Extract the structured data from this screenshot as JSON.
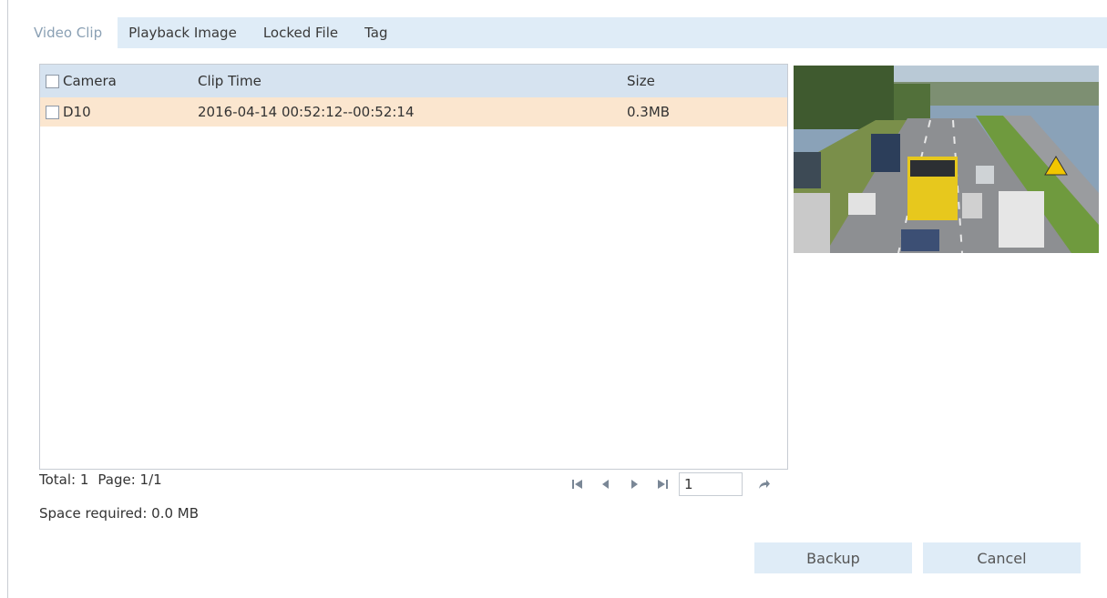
{
  "tabs": [
    {
      "label": "Video Clip",
      "active": true
    },
    {
      "label": "Playback Image",
      "active": false
    },
    {
      "label": "Locked File",
      "active": false
    },
    {
      "label": "Tag",
      "active": false
    }
  ],
  "table": {
    "headers": {
      "camera": "Camera",
      "clip_time": "Clip Time",
      "size": "Size"
    },
    "rows": [
      {
        "camera": "D10",
        "clip_time": "2016-04-14 00:52:12--00:52:14",
        "size": "0.3MB",
        "highlighted": true
      }
    ]
  },
  "footer": {
    "total": "Total: 1",
    "page": "Page: 1/1",
    "space_required": "Space required: 0.0 MB"
  },
  "pager": {
    "page_value": "1",
    "icons": [
      "first-page-icon",
      "prev-page-icon",
      "next-page-icon",
      "last-page-icon",
      "go-icon"
    ]
  },
  "preview": {
    "icon": "highway-traffic-image"
  },
  "buttons": {
    "backup": "Backup",
    "cancel": "Cancel"
  },
  "colors": {
    "tab_bar": "#dfecf7",
    "header": "#d6e3f0",
    "selected_row": "#fbe6cf",
    "active_tab_text": "#8aa0b4"
  }
}
